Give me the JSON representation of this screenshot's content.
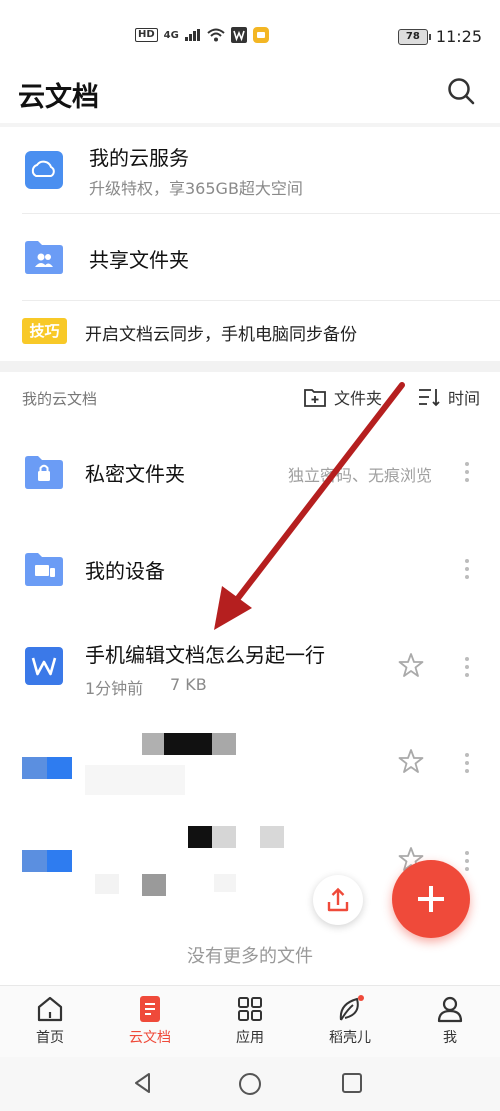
{
  "status_bar": {
    "left_indicators": "HD 4G",
    "battery": "78",
    "time": "11:25"
  },
  "header": {
    "title": "云文档",
    "search_icon": "search-icon"
  },
  "quick_rows": [
    {
      "title": "我的云服务",
      "subtitle": "升级特权，享365GB超大空间",
      "icon": "cloud-icon",
      "color": "#4a8ff0"
    },
    {
      "title": "共享文件夹",
      "icon": "shared-folder-icon",
      "color": "#6b9cf5"
    }
  ],
  "tip": {
    "badge": "技巧",
    "text": "开启文档云同步，手机电脑同步备份"
  },
  "section": {
    "title": "我的云文档",
    "folder_action": "文件夹",
    "sort_action": "时间"
  },
  "files": [
    {
      "name": "私密文件夹",
      "hint": "独立密码、无痕浏览",
      "icon": "lock-folder-icon"
    },
    {
      "name": "我的设备",
      "icon": "device-folder-icon"
    },
    {
      "name": "手机编辑文档怎么另起一行",
      "time": "1分钟前",
      "size": "7 KB",
      "icon": "word-doc-icon"
    }
  ],
  "footer_note": "没有更多的文件",
  "tabs": [
    {
      "label": "首页",
      "icon": "home-icon"
    },
    {
      "label": "云文档",
      "icon": "cloud-doc-icon",
      "active": true
    },
    {
      "label": "应用",
      "icon": "apps-grid-icon"
    },
    {
      "label": "稻壳儿",
      "icon": "leaf-icon"
    },
    {
      "label": "我",
      "icon": "profile-icon"
    }
  ],
  "colors": {
    "accent": "#ef4a3a",
    "tip_badge": "#f8c928",
    "annotation_arrow": "#b51f1f"
  }
}
